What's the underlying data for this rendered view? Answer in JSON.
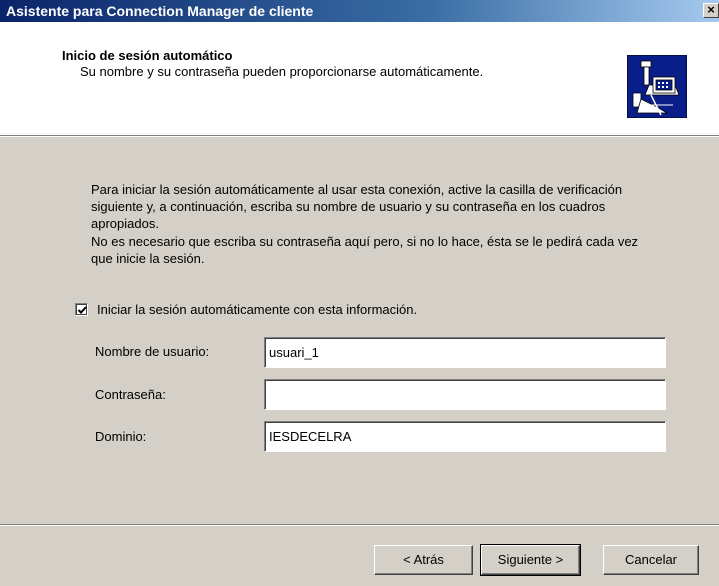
{
  "window": {
    "title": "Asistente para Connection Manager de cliente",
    "close_glyph": "×"
  },
  "header": {
    "title": "Inicio de sesión automático",
    "subtitle": "Su nombre y su contraseña pueden proporcionarse automáticamente.",
    "icon": "network-computer-icon"
  },
  "body": {
    "paragraph1": "Para iniciar la sesión automáticamente al usar esta conexión, active la casilla de verificación siguiente y, a continuación, escriba su nombre de usuario y su contraseña en los cuadros apropiados.",
    "paragraph2": "No es necesario que escriba su contraseña aquí pero, si no lo hace, ésta se le pedirá cada vez que inicie la sesión."
  },
  "auto_login": {
    "label": "Iniciar la sesión automáticamente con esta información.",
    "checked": true
  },
  "fields": {
    "username": {
      "label": "Nombre de usuario:",
      "value": "usuari_1"
    },
    "password": {
      "label": "Contraseña:",
      "value": ""
    },
    "domain": {
      "label": "Dominio:",
      "value": "IESDECELRA"
    }
  },
  "buttons": {
    "back": "< Atrás",
    "next": "Siguiente >",
    "cancel": "Cancelar"
  }
}
